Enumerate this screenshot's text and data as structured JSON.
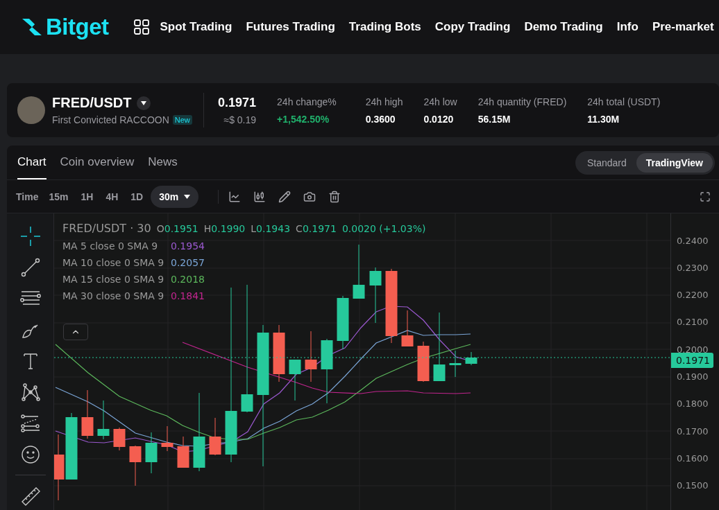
{
  "nav": {
    "logo": "Bitget",
    "items": [
      "Spot Trading",
      "Futures Trading",
      "Trading Bots",
      "Copy Trading",
      "Demo Trading",
      "Info",
      "Pre-market"
    ]
  },
  "ticker": {
    "pair": "FRED/USDT",
    "name": "First Convicted RACCOON",
    "badge": "New",
    "price": "0.1971",
    "price_usd": "≈$ 0.19",
    "stats": [
      {
        "label": "24h change%",
        "value": "+1,542.50%",
        "kind": "change"
      },
      {
        "label": "24h high",
        "value": "0.3600",
        "kind": "plain"
      },
      {
        "label": "24h low",
        "value": "0.0120",
        "kind": "plain"
      },
      {
        "label": "24h quantity (FRED)",
        "value": "56.15M",
        "kind": "plain"
      },
      {
        "label": "24h total (USDT)",
        "value": "11.30M",
        "kind": "plain"
      }
    ]
  },
  "panel_tabs": [
    {
      "label": "Chart",
      "selected": true
    },
    {
      "label": "Coin overview",
      "selected": false
    },
    {
      "label": "News",
      "selected": false
    }
  ],
  "view_switch": [
    {
      "label": "Standard",
      "selected": false
    },
    {
      "label": "TradingView",
      "selected": true
    }
  ],
  "intervals": [
    {
      "label": "Time",
      "kind": "label"
    },
    {
      "label": "15m",
      "kind": "option",
      "selected": false
    },
    {
      "label": "1H",
      "kind": "option",
      "selected": false
    },
    {
      "label": "4H",
      "kind": "option",
      "selected": false
    },
    {
      "label": "1D",
      "kind": "option",
      "selected": false
    },
    {
      "label": "30m",
      "kind": "dropdown",
      "selected": true
    }
  ],
  "chart": {
    "symbol": "FRED/USDT · 30",
    "ohlc": [
      {
        "key": "O",
        "value": "0.1951"
      },
      {
        "key": "H",
        "value": "0.1990"
      },
      {
        "key": "L",
        "value": "0.1943"
      },
      {
        "key": "C",
        "value": "0.1971"
      }
    ],
    "change": "0.0020 (+1.03%)",
    "indicators": [
      {
        "label": "MA 5 close 0 SMA 9",
        "value": "0.1954",
        "color": "#9b59d0"
      },
      {
        "label": "MA 10 close 0 SMA 9",
        "value": "0.2057",
        "color": "#7ba6d8"
      },
      {
        "label": "MA 15 close 0 SMA 9",
        "value": "0.2018",
        "color": "#5cb85c"
      },
      {
        "label": "MA 30 close 0 SMA 9",
        "value": "0.1841",
        "color": "#c2258f"
      }
    ],
    "price_axis": [
      "0.2400",
      "0.2300",
      "0.2200",
      "0.2100",
      "0.2000",
      "0.1900",
      "0.1800",
      "0.1700",
      "0.1600",
      "0.1500"
    ],
    "last_price": "0.1971"
  }
}
